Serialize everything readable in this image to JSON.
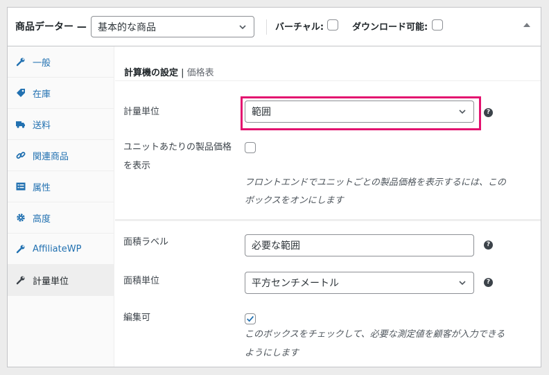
{
  "header": {
    "title": "商品データー —",
    "product_type": "基本的な商品",
    "virtual_label": "バーチャル:",
    "virtual_checked": false,
    "downloadable_label": "ダウンロード可能:",
    "downloadable_checked": false
  },
  "sidebar": {
    "items": [
      {
        "label": "一般",
        "icon": "wrench-icon"
      },
      {
        "label": "在庫",
        "icon": "tag-icon"
      },
      {
        "label": "送料",
        "icon": "truck-icon"
      },
      {
        "label": "関連商品",
        "icon": "link-icon"
      },
      {
        "label": "属性",
        "icon": "list-icon"
      },
      {
        "label": "高度",
        "icon": "gear-icon"
      },
      {
        "label": "AffiliateWP",
        "icon": "wrench-icon"
      },
      {
        "label": "計量単位",
        "icon": "wrench-icon",
        "active": true
      }
    ]
  },
  "main": {
    "sub_title": "計算機の設定",
    "sub_sep": " | ",
    "sub_suffix": "価格表",
    "unit_label": "計量単位",
    "unit_value": "範囲",
    "per_unit_label_line1": "ユニットあたりの製品価格",
    "per_unit_label_line2": "を表示",
    "per_unit_checked": false,
    "per_unit_desc_line1": "フロントエンドでユニットごとの製品価格を表示するには、この",
    "per_unit_desc_line2": "ボックスをオンにします",
    "area_label_label": "面積ラベル",
    "area_label_value": "必要な範囲",
    "area_unit_label": "面積単位",
    "area_unit_value": "平方センチメートル",
    "editable_label": "編集可",
    "editable_checked": true,
    "editable_desc_line1": "このボックスをチェックして、必要な測定値を顧客が入力できる",
    "editable_desc_line2": "ようにします",
    "help_glyph": "?"
  },
  "colors": {
    "highlight": "#e3126f",
    "link": "#2271b1",
    "checkmark": "#2271b1"
  }
}
